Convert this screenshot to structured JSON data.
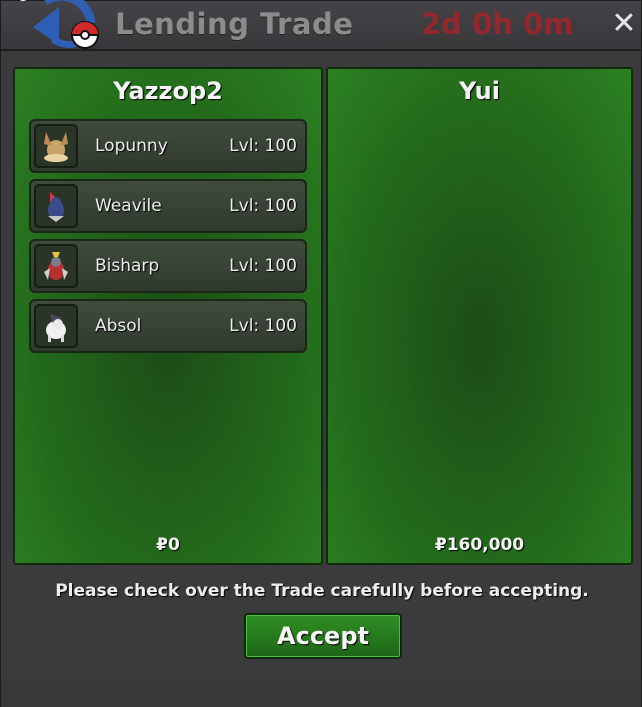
{
  "window": {
    "title": "Lending Trade",
    "timer": "2d 0h 0m",
    "close_label": "✕",
    "logo_icon": "pokeball-swap-icon"
  },
  "left_panel": {
    "player": "Yazzop2",
    "money": "₽0",
    "pokemon": [
      {
        "name": "Lopunny",
        "level": "Lvl: 100",
        "icon": "lopunny-sprite-icon"
      },
      {
        "name": "Weavile",
        "level": "Lvl: 100",
        "icon": "weavile-sprite-icon"
      },
      {
        "name": "Bisharp",
        "level": "Lvl: 100",
        "icon": "bisharp-sprite-icon"
      },
      {
        "name": "Absol",
        "level": "Lvl: 100",
        "icon": "absol-sprite-icon"
      }
    ]
  },
  "right_panel": {
    "player": "Yui",
    "money": "₽160,000"
  },
  "notice": "Please check over the Trade carefully before accepting.",
  "accept_label": "Accept",
  "colors": {
    "panel_green": "#236a1b",
    "timer_red": "#a4242a",
    "accept_green": "#2f8f24"
  }
}
